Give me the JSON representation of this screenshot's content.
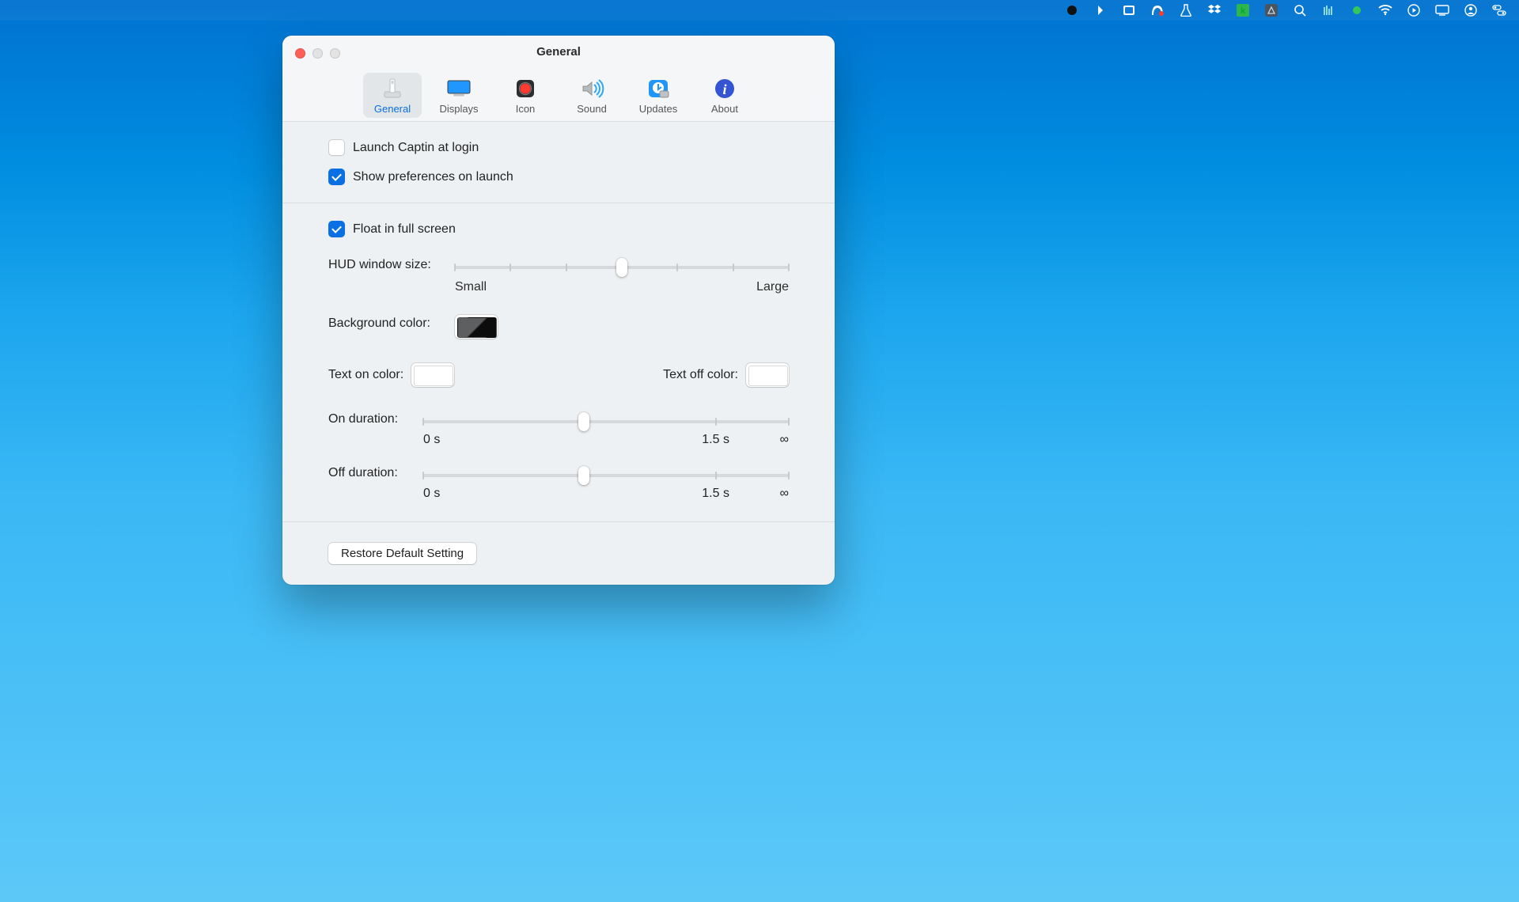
{
  "menubar": {
    "items": [
      "record-icon",
      "chevron-right-icon",
      "document-icon",
      "malwarebytes-icon",
      "flask-icon",
      "dropbox-icon",
      "k-icon",
      "triangle-icon",
      "search-icon",
      "bars-icon",
      "status-dot-icon",
      "wifi-icon",
      "play-circle-icon",
      "display-icon",
      "person-circle-icon",
      "control-center-icon"
    ]
  },
  "window": {
    "title": "General",
    "tabs": [
      {
        "id": "general",
        "label": "General"
      },
      {
        "id": "displays",
        "label": "Displays"
      },
      {
        "id": "icon",
        "label": "Icon"
      },
      {
        "id": "sound",
        "label": "Sound"
      },
      {
        "id": "updates",
        "label": "Updates"
      },
      {
        "id": "about",
        "label": "About"
      }
    ],
    "selected_tab": "general"
  },
  "settings": {
    "launch_at_login": {
      "label": "Launch Captin at login",
      "checked": false
    },
    "show_prefs": {
      "label": "Show preferences on launch",
      "checked": true
    },
    "float_fullscreen": {
      "label": "Float in full screen",
      "checked": true
    },
    "hud_size": {
      "label": "HUD window size:",
      "min_label": "Small",
      "max_label": "Large",
      "ticks": 7,
      "value_index": 3
    },
    "background_color": {
      "label": "Background color:",
      "value": "black-gradient"
    },
    "text_on_color": {
      "label": "Text on color:",
      "value": "#ffffff"
    },
    "text_off_color": {
      "label": "Text off color:",
      "value": "#ffffff"
    },
    "on_duration": {
      "label": "On duration:",
      "min_label": "0 s",
      "mid_label": "1.5 s",
      "max_label": "∞",
      "value_pct": 44
    },
    "off_duration": {
      "label": "Off duration:",
      "min_label": "0 s",
      "mid_label": "1.5 s",
      "max_label": "∞",
      "value_pct": 44
    }
  },
  "footer": {
    "restore_label": "Restore Default Setting"
  }
}
